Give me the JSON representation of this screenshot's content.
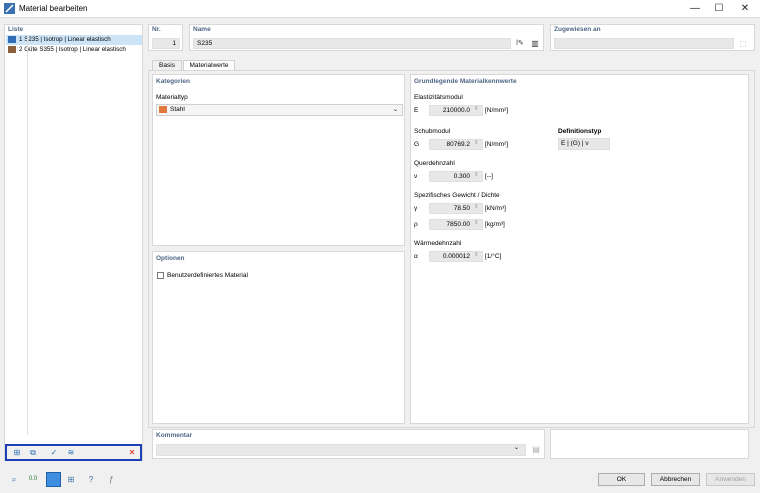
{
  "window": {
    "title": "Material bearbeiten",
    "minimize": "—",
    "maximize": "☐",
    "close": "✕"
  },
  "list": {
    "header": "Liste",
    "items": [
      {
        "num": "1",
        "text": "S235 | Isotrop | Linear elastisch",
        "color": "#2f6db5",
        "selected": true
      },
      {
        "num": "2",
        "text": "Güte S355 | Isotrop | Linear elastisch",
        "color": "#8b5e3c",
        "selected": false
      }
    ]
  },
  "nr": {
    "label": "Nr.",
    "value": "1"
  },
  "name": {
    "label": "Name",
    "value": "S235"
  },
  "assigned": {
    "label": "Zugewiesen an",
    "value": ""
  },
  "tabs": [
    {
      "label": "Basis"
    },
    {
      "label": "Materialwerte"
    }
  ],
  "categories": {
    "header": "Kategorien",
    "type_label": "Materialtyp",
    "type_value": "Stahl",
    "type_color": "#e07a3c"
  },
  "options": {
    "header": "Optionen",
    "custom_material": "Benutzerdefiniertes Material"
  },
  "basic": {
    "header": "Grundlegende Materialkennwerte",
    "elastic": {
      "title": "Elastizitätsmodul",
      "symbol": "E",
      "value": "210000.0",
      "unit": "[N/mm²]"
    },
    "shear": {
      "title": "Schubmodul",
      "symbol": "G",
      "value": "80769.2",
      "unit": "[N/mm²]"
    },
    "deftype": {
      "title": "Definitionstyp",
      "value": "E | (G) | ν"
    },
    "poisson": {
      "title": "Querdehnzahl",
      "symbol": "ν",
      "value": "0.300",
      "unit": "[--]"
    },
    "weight": {
      "title": "Spezifisches Gewicht / Dichte",
      "gamma_symbol": "γ",
      "gamma_value": "78.50",
      "gamma_unit": "[kN/m³]",
      "rho_symbol": "ρ",
      "rho_value": "7850.00",
      "rho_unit": "[kg/m³]"
    },
    "thermal": {
      "title": "Wärmedehnzahl",
      "symbol": "α",
      "value": "0.000012",
      "unit": "[1/°C]"
    }
  },
  "comment": {
    "label": "Kommentar",
    "value": ""
  },
  "buttons": {
    "ok": "OK",
    "cancel": "Abbrechen",
    "apply": "Anwenden"
  },
  "highlight_color": "#1e3fb8"
}
